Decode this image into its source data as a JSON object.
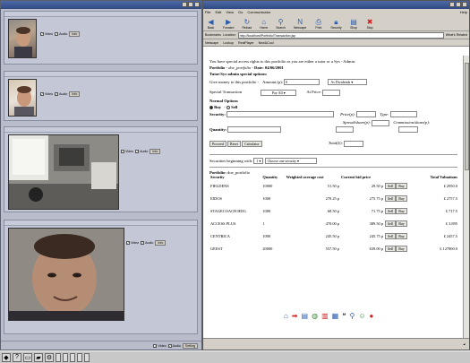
{
  "conference": {
    "title": "",
    "participants": [
      {
        "header": "",
        "info": [],
        "controls": [
          "Video",
          "Audio",
          "Info"
        ]
      },
      {
        "header": "",
        "info": [],
        "controls": [
          "Video",
          "Audio",
          "Info"
        ]
      },
      {
        "header": "",
        "info": [],
        "controls": [
          "Video",
          "Audio",
          "Info"
        ]
      },
      {
        "header": "",
        "info": [],
        "controls": [
          "Video",
          "Audio",
          "Info"
        ]
      }
    ],
    "footer_controls": [
      "Video",
      "Audio",
      "Setting"
    ]
  },
  "browser": {
    "title": "",
    "menu": [
      "File",
      "Edit",
      "View",
      "Go",
      "Communicator",
      "Help"
    ],
    "nav_buttons": [
      {
        "label": "Back",
        "icon": "back-arrow-icon"
      },
      {
        "label": "Forward",
        "icon": "forward-arrow-icon"
      },
      {
        "label": "Reload",
        "icon": "reload-icon"
      },
      {
        "label": "Home",
        "icon": "home-icon"
      },
      {
        "label": "Search",
        "icon": "search-icon"
      },
      {
        "label": "Netscape",
        "icon": "netscape-icon"
      },
      {
        "label": "Print",
        "icon": "print-icon"
      },
      {
        "label": "Security",
        "icon": "lock-icon"
      },
      {
        "label": "Shop",
        "icon": "shop-icon"
      },
      {
        "label": "Stop",
        "icon": "stop-icon"
      }
    ],
    "location": {
      "bookmarks_label": "Bookmarks",
      "location_label": "Location:",
      "url": "http://localhost/Portfolio/Transaction.jsp",
      "related_label": "What's Related"
    },
    "bookmarks_bar": [
      "Netscape",
      "Lookup",
      "RealPlayer",
      "New&Cool"
    ]
  },
  "page": {
    "access_notice": "You have special access rights to this portfolio as you are either a tutor or a Sys - Admin.",
    "portfolio_line": {
      "label": "Portfolio -",
      "name": "doe_portfolio",
      "date_label": "- Date: 04/06/2001"
    },
    "special_options_title": "Tutor/Sys-admin special options:",
    "give_money_label": "Give money to this portfolio -",
    "amount_label": "Amount (p):",
    "amount_value": "0",
    "dividends_option": "As Dividends",
    "special_transaction_label": "Special Transaction",
    "pay_all_option": "Pay All",
    "at_price_label": "At Price:",
    "normal_options_title": "Normal Options",
    "buy_label": "Buy",
    "sell_label": "Sell",
    "security_label": "Security:",
    "price_label": "Price(p):",
    "type_label": "Type:",
    "quantity_label": "Quantity:",
    "spread_label": "Spread/share(p):",
    "commission_label": "Commission/share(p):",
    "proceed_label": "Proceed",
    "reset_label": "Reset",
    "calculator_label": "Calculator",
    "total_label": "Total(£):",
    "securities_beginning_label": "Securities beginning with:",
    "letter_value": "1",
    "choose_security_option": "Choose one security",
    "portfolio_table_label": "Portfolio:",
    "portfolio_table_name": "doe_portfolio",
    "table": {
      "headers": [
        "Security",
        "Quantity",
        "Weighted average cost",
        "Current bid price",
        "",
        "Total Valuations"
      ],
      "sell_label": "Sell",
      "buy_label": "Buy",
      "rows": [
        {
          "security": "FIELDENS",
          "quantity": "10000",
          "wac": "51.50 p",
          "bid": "29.50 p",
          "total": "£ 2950.0"
        },
        {
          "security": "EIDOS",
          "quantity": "1000",
          "wac": "270.25 p",
          "bid": "275.75 p",
          "total": "£ 2757.5"
        },
        {
          "security": "STAGECOACH HDG",
          "quantity": "1000",
          "wac": "68.50 p",
          "bid": "71.75 p",
          "total": "£ 717.5"
        },
        {
          "security": "ACCESS PLUS",
          "quantity": "1",
          "wac": "470.00 p",
          "bid": "389.50 p",
          "total": "£ 3.895"
        },
        {
          "security": "CENTRICA",
          "quantity": "1000",
          "wac": "245.50 p",
          "bid": "245.75 p",
          "total": "£ 2457.5"
        },
        {
          "security": "GEEST",
          "quantity": "20000",
          "wac": "557.50 p",
          "bid": "639.00 p",
          "total": "£ 127800.0"
        }
      ]
    }
  },
  "taskbar": {
    "tasks": [
      "",
      "",
      "",
      "",
      ""
    ],
    "clock_time": "",
    "clock_date": ""
  }
}
